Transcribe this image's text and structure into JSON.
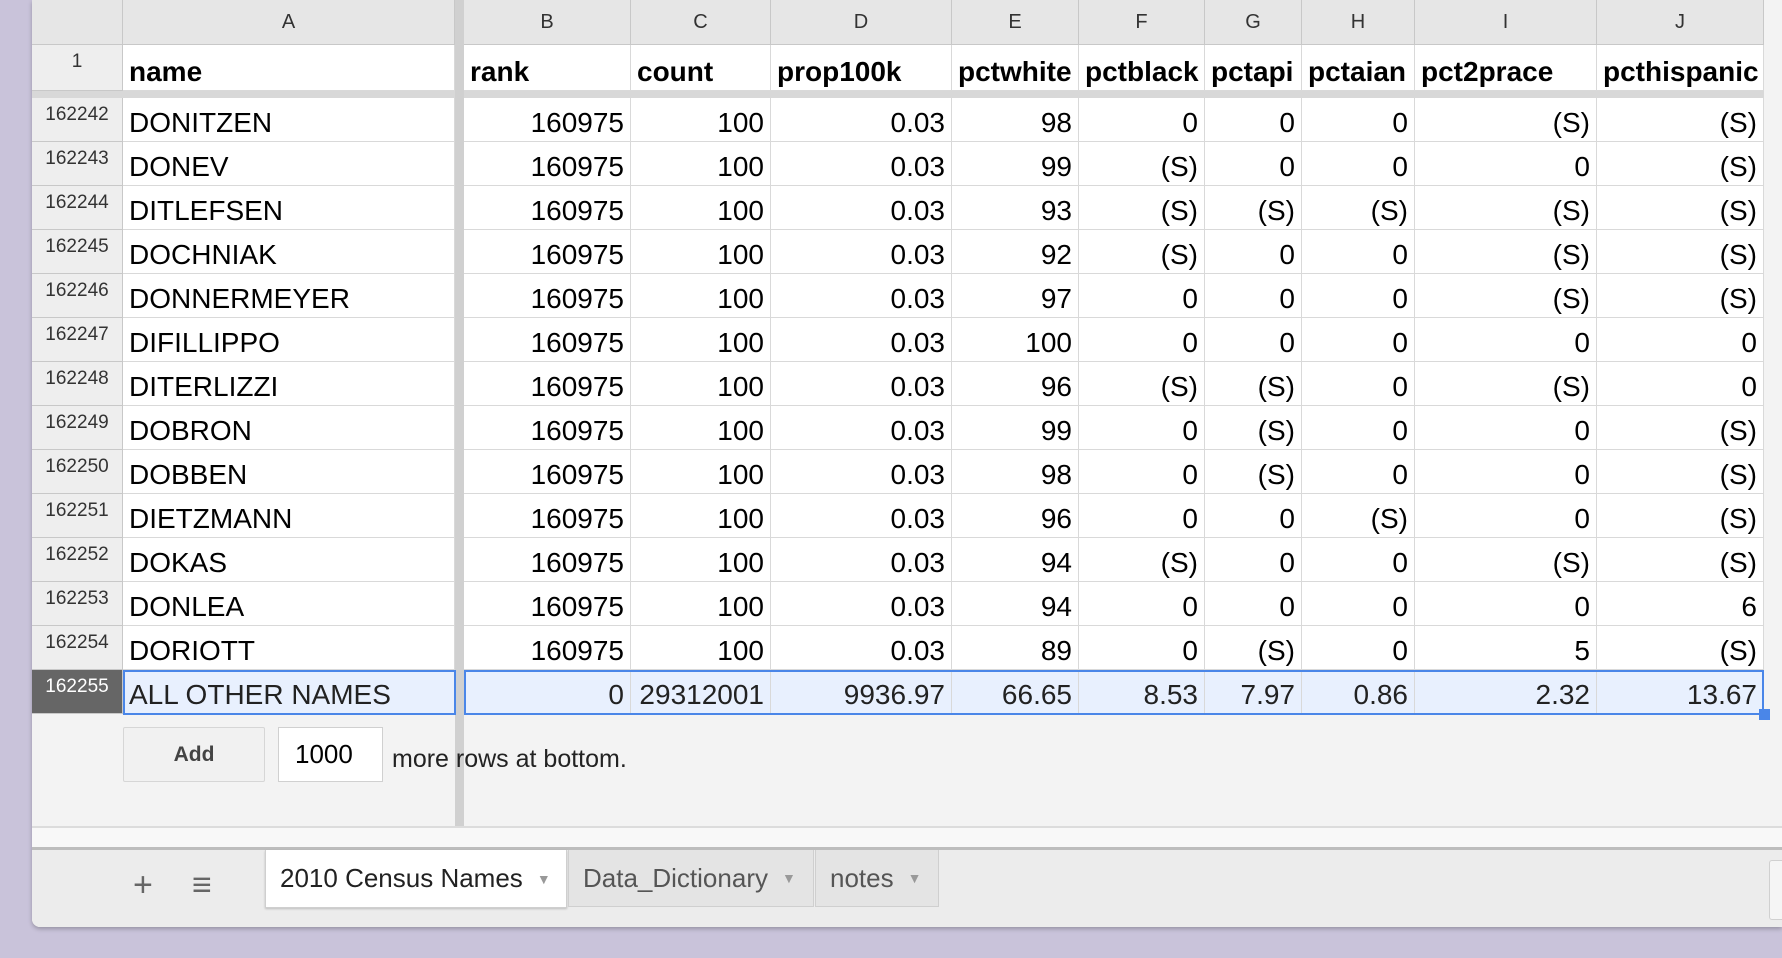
{
  "columns": [
    "A",
    "B",
    "C",
    "D",
    "E",
    "F",
    "G",
    "H",
    "I",
    "J"
  ],
  "header_row": {
    "number": "1",
    "cells": [
      "name",
      "rank",
      "count",
      "prop100k",
      "pctwhite",
      "pctblack",
      "pctapi",
      "pctaian",
      "pct2prace",
      "pcthispanic"
    ]
  },
  "rows": [
    {
      "number": "162242",
      "cells": [
        "DONITZEN",
        "160975",
        "100",
        "0.03",
        "98",
        "0",
        "0",
        "0",
        "(S)",
        "(S)"
      ]
    },
    {
      "number": "162243",
      "cells": [
        "DONEV",
        "160975",
        "100",
        "0.03",
        "99",
        "(S)",
        "0",
        "0",
        "0",
        "(S)"
      ]
    },
    {
      "number": "162244",
      "cells": [
        "DITLEFSEN",
        "160975",
        "100",
        "0.03",
        "93",
        "(S)",
        "(S)",
        "(S)",
        "(S)",
        "(S)"
      ]
    },
    {
      "number": "162245",
      "cells": [
        "DOCHNIAK",
        "160975",
        "100",
        "0.03",
        "92",
        "(S)",
        "0",
        "0",
        "(S)",
        "(S)"
      ]
    },
    {
      "number": "162246",
      "cells": [
        "DONNERMEYER",
        "160975",
        "100",
        "0.03",
        "97",
        "0",
        "0",
        "0",
        "(S)",
        "(S)"
      ]
    },
    {
      "number": "162247",
      "cells": [
        "DIFILLIPPO",
        "160975",
        "100",
        "0.03",
        "100",
        "0",
        "0",
        "0",
        "0",
        "0"
      ]
    },
    {
      "number": "162248",
      "cells": [
        "DITERLIZZI",
        "160975",
        "100",
        "0.03",
        "96",
        "(S)",
        "(S)",
        "0",
        "(S)",
        "0"
      ]
    },
    {
      "number": "162249",
      "cells": [
        "DOBRON",
        "160975",
        "100",
        "0.03",
        "99",
        "0",
        "(S)",
        "0",
        "0",
        "(S)"
      ]
    },
    {
      "number": "162250",
      "cells": [
        "DOBBEN",
        "160975",
        "100",
        "0.03",
        "98",
        "0",
        "(S)",
        "0",
        "0",
        "(S)"
      ]
    },
    {
      "number": "162251",
      "cells": [
        "DIETZMANN",
        "160975",
        "100",
        "0.03",
        "96",
        "0",
        "0",
        "(S)",
        "0",
        "(S)"
      ]
    },
    {
      "number": "162252",
      "cells": [
        "DOKAS",
        "160975",
        "100",
        "0.03",
        "94",
        "(S)",
        "0",
        "0",
        "(S)",
        "(S)"
      ]
    },
    {
      "number": "162253",
      "cells": [
        "DONLEA",
        "160975",
        "100",
        "0.03",
        "94",
        "0",
        "0",
        "0",
        "0",
        "6"
      ]
    },
    {
      "number": "162254",
      "cells": [
        "DORIOTT",
        "160975",
        "100",
        "0.03",
        "89",
        "0",
        "(S)",
        "0",
        "5",
        "(S)"
      ]
    },
    {
      "number": "162255",
      "cells": [
        "ALL OTHER NAMES",
        "0",
        "29312001",
        "9936.97",
        "66.65",
        "8.53",
        "7.97",
        "0.86",
        "2.32",
        "13.67"
      ],
      "selected": true
    }
  ],
  "add_rows": {
    "button_label": "Add",
    "count_value": "1000",
    "suffix_text": "more rows at bottom."
  },
  "sheet_tabs": [
    {
      "label": "2010 Census Names",
      "active": true
    },
    {
      "label": "Data_Dictionary",
      "active": false
    },
    {
      "label": "notes",
      "active": false
    }
  ],
  "icons": {
    "add_sheet": "plus-icon",
    "all_sheets": "list-icon",
    "tab_menu": "caret-down-icon"
  },
  "colors": {
    "selection": "#4a86e8",
    "selection_fill": "#e8f0fe"
  }
}
